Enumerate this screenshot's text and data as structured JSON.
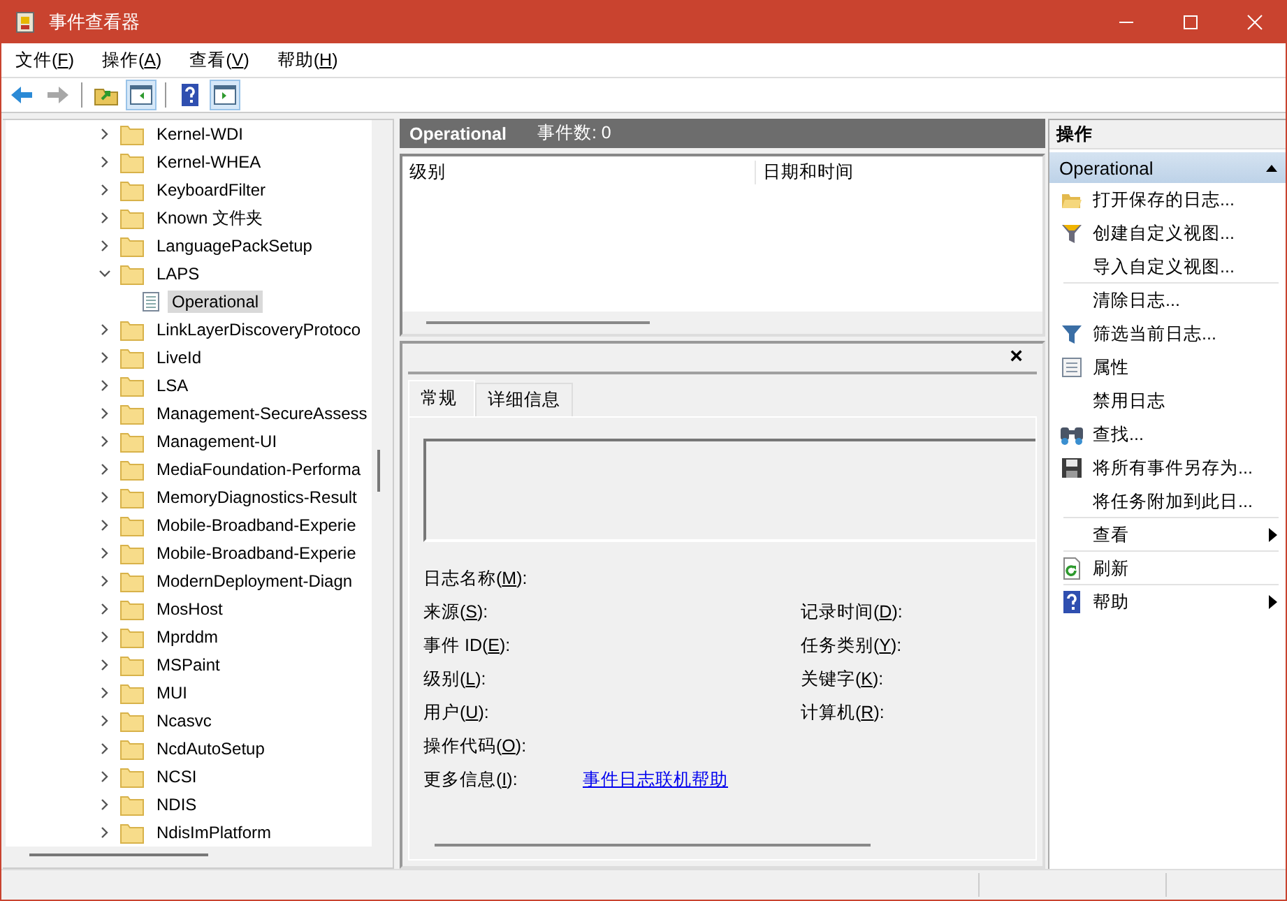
{
  "window": {
    "title": "事件查看器"
  },
  "menu": [
    {
      "before": "文件(",
      "key": "F",
      "after": ")"
    },
    {
      "before": "操作(",
      "key": "A",
      "after": ")"
    },
    {
      "before": "查看(",
      "key": "V",
      "after": ")"
    },
    {
      "before": "帮助(",
      "key": "H",
      "after": ")"
    }
  ],
  "toolbar": [
    [
      {
        "kind": "back",
        "disabled": false,
        "pressed": false
      },
      {
        "kind": "forward",
        "disabled": true,
        "pressed": false
      }
    ],
    [
      {
        "kind": "up-folder",
        "disabled": false,
        "pressed": false
      },
      {
        "kind": "tree-pane",
        "disabled": false,
        "pressed": true
      }
    ],
    [
      {
        "kind": "help",
        "disabled": false,
        "pressed": false
      },
      {
        "kind": "action-pane",
        "disabled": false,
        "pressed": true
      }
    ]
  ],
  "tree": [
    {
      "label": "Kernel-WDI",
      "expanded": false,
      "selected": false
    },
    {
      "label": "Kernel-WHEA",
      "expanded": false,
      "selected": false
    },
    {
      "label": "KeyboardFilter",
      "expanded": false,
      "selected": false
    },
    {
      "label": "Known 文件夹",
      "expanded": false,
      "selected": false
    },
    {
      "label": "LanguagePackSetup",
      "expanded": false,
      "selected": false
    },
    {
      "label": "LAPS",
      "expanded": true,
      "selected": false,
      "children": [
        {
          "label": "Operational",
          "selected": true
        }
      ]
    },
    {
      "label": "LinkLayerDiscoveryProtoco",
      "expanded": false,
      "selected": false
    },
    {
      "label": "LiveId",
      "expanded": false,
      "selected": false
    },
    {
      "label": "LSA",
      "expanded": false,
      "selected": false
    },
    {
      "label": "Management-SecureAssess",
      "expanded": false,
      "selected": false
    },
    {
      "label": "Management-UI",
      "expanded": false,
      "selected": false
    },
    {
      "label": "MediaFoundation-Performa",
      "expanded": false,
      "selected": false
    },
    {
      "label": "MemoryDiagnostics-Result",
      "expanded": false,
      "selected": false
    },
    {
      "label": "Mobile-Broadband-Experie",
      "expanded": false,
      "selected": false
    },
    {
      "label": "Mobile-Broadband-Experie",
      "expanded": false,
      "selected": false
    },
    {
      "label": "ModernDeployment-Diagn",
      "expanded": false,
      "selected": false
    },
    {
      "label": "MosHost",
      "expanded": false,
      "selected": false
    },
    {
      "label": "Mprddm",
      "expanded": false,
      "selected": false
    },
    {
      "label": "MSPaint",
      "expanded": false,
      "selected": false
    },
    {
      "label": "MUI",
      "expanded": false,
      "selected": false
    },
    {
      "label": "Ncasvc",
      "expanded": false,
      "selected": false
    },
    {
      "label": "NcdAutoSetup",
      "expanded": false,
      "selected": false
    },
    {
      "label": "NCSI",
      "expanded": false,
      "selected": false
    },
    {
      "label": "NDIS",
      "expanded": false,
      "selected": false
    },
    {
      "label": "NdisImPlatform",
      "expanded": false,
      "selected": false
    }
  ],
  "log": {
    "title": "Operational",
    "count": "事件数: 0",
    "columns": [
      "级别",
      "日期和时间"
    ]
  },
  "detail": {
    "close": "×",
    "tabs": [
      {
        "label": "常规",
        "selected": true
      },
      {
        "label": "详细信息",
        "selected": false
      }
    ],
    "rows": [
      {
        "left": {
          "before": "日志名称(",
          "key": "M",
          "after": "):"
        }
      },
      {
        "left": {
          "before": "来源(",
          "key": "S",
          "after": "):"
        },
        "right": {
          "before": "记录时间(",
          "key": "D",
          "after": "):"
        }
      },
      {
        "left": {
          "before": "事件 ID(",
          "key": "E",
          "after": "):"
        },
        "right": {
          "before": "任务类别(",
          "key": "Y",
          "after": "):"
        }
      },
      {
        "left": {
          "before": "级别(",
          "key": "L",
          "after": "):"
        },
        "right": {
          "before": "关键字(",
          "key": "K",
          "after": "):"
        }
      },
      {
        "left": {
          "before": "用户(",
          "key": "U",
          "after": "):"
        },
        "right": {
          "before": "计算机(",
          "key": "R",
          "after": "):"
        }
      },
      {
        "left": {
          "before": "操作代码(",
          "key": "O",
          "after": "):"
        }
      },
      {
        "left": {
          "before": "更多信息(",
          "key": "I",
          "after": "):"
        },
        "link": "事件日志联机帮助"
      }
    ]
  },
  "actions": {
    "title": "操作",
    "section": {
      "label": "Operational",
      "expanded": true
    },
    "items": [
      {
        "label": "打开保存的日志...",
        "kind": "open-folder",
        "submenu": false,
        "separator_after": false
      },
      {
        "label": "创建自定义视图...",
        "kind": "filter-star",
        "submenu": false,
        "separator_after": false
      },
      {
        "label": "导入自定义视图...",
        "submenu": false,
        "separator_after": true
      },
      {
        "label": "清除日志...",
        "submenu": false,
        "separator_after": false
      },
      {
        "label": "筛选当前日志...",
        "kind": "filter",
        "submenu": false,
        "separator_after": false
      },
      {
        "label": "属性",
        "kind": "properties",
        "submenu": false,
        "separator_after": false
      },
      {
        "label": "禁用日志",
        "submenu": false,
        "separator_after": false
      },
      {
        "label": "查找...",
        "kind": "binoculars",
        "submenu": false,
        "separator_after": false
      },
      {
        "label": "将所有事件另存为...",
        "kind": "floppy",
        "submenu": false,
        "separator_after": false
      },
      {
        "label": "将任务附加到此日...",
        "submenu": false,
        "separator_after": true
      },
      {
        "label": "查看",
        "submenu": true,
        "separator_after": true
      },
      {
        "label": "刷新",
        "kind": "refresh",
        "submenu": false,
        "separator_after": true
      },
      {
        "label": "帮助",
        "kind": "help",
        "submenu": true,
        "separator_after": false
      }
    ]
  }
}
